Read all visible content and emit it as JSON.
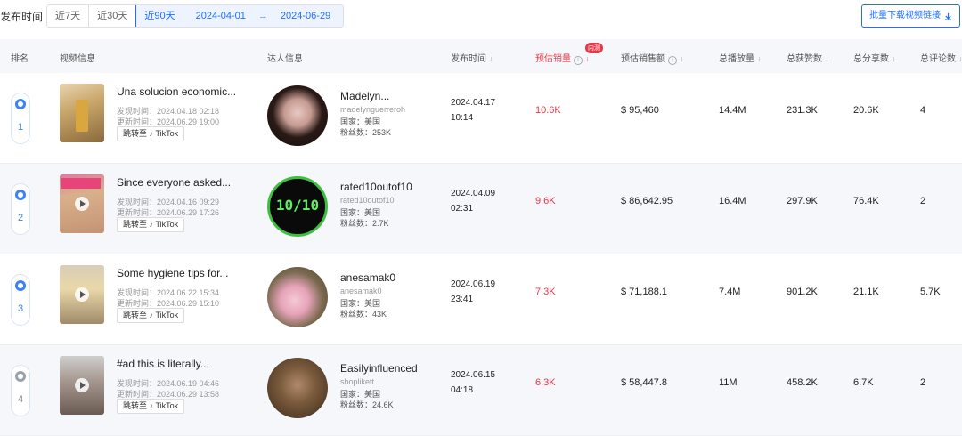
{
  "filter": {
    "label": "发布时间",
    "ranges": [
      "近7天",
      "近30天",
      "近90天"
    ],
    "date_start": "2024-04-01",
    "date_sep": "→",
    "date_end": "2024-06-29",
    "download_label": "批量下载视频链接"
  },
  "header": {
    "rank": "排名",
    "video": "视频信息",
    "creator": "达人信息",
    "publish": "发布时间",
    "sales": "预估销量",
    "revenue": "预估销售额",
    "plays": "总播放量",
    "likes": "总获赞数",
    "shares": "总分享数",
    "comments": "总评论数",
    "badge": "内测"
  },
  "labels": {
    "published_prefix": "发现时间：",
    "updated_prefix": "更新时间：",
    "country_prefix": "国家：",
    "fans_prefix": "粉丝数：",
    "tiktok_btn": "跳转至 ♪ TikTok"
  },
  "rows": [
    {
      "rank": "1",
      "title": "Una solucion economic...",
      "found": "发现时间：2024.04.18 02:18",
      "updated": "更新时间：2024.06.29 19:00",
      "creator_name": "Madelyn...",
      "creator_handle": "madelynguerreroh",
      "country": "国家：美国",
      "fans": "粉丝数：253K",
      "pub_date": "2024.04.17",
      "pub_time": "10:14",
      "sales": "10.6K",
      "revenue": "$ 95,460",
      "plays": "14.4M",
      "likes": "231.3K",
      "shares": "20.6K",
      "comments": "4"
    },
    {
      "rank": "2",
      "title": "Since everyone asked...",
      "found": "发现时间：2024.04.16 09:29",
      "updated": "更新时间：2024.06.29 17:26",
      "creator_name": "rated10outof10",
      "creator_handle": "rated10outof10",
      "country": "国家：美国",
      "fans": "粉丝数：2.7K",
      "pub_date": "2024.04.09",
      "pub_time": "02:31",
      "sales": "9.6K",
      "revenue": "$ 86,642.95",
      "plays": "16.4M",
      "likes": "297.9K",
      "shares": "76.4K",
      "comments": "2",
      "avatar_text": "10/10"
    },
    {
      "rank": "3",
      "title": "Some hygiene tips for...",
      "found": "发现时间：2024.06.22 15:34",
      "updated": "更新时间：2024.06.29 15:10",
      "creator_name": "anesamak0",
      "creator_handle": "anesamak0",
      "country": "国家：美国",
      "fans": "粉丝数：43K",
      "pub_date": "2024.06.19",
      "pub_time": "23:41",
      "sales": "7.3K",
      "revenue": "$ 71,188.1",
      "plays": "7.4M",
      "likes": "901.2K",
      "shares": "21.1K",
      "comments": "5.7K"
    },
    {
      "rank": "4",
      "title": "#ad this is literally...",
      "found": "发现时间：2024.06.19 04:46",
      "updated": "更新时间：2024.06.29 13:58",
      "creator_name": "Easilyinfluenced",
      "creator_handle": "shoplikett",
      "country": "国家：美国",
      "fans": "粉丝数：24.6K",
      "pub_date": "2024.06.15",
      "pub_time": "04:18",
      "sales": "6.3K",
      "revenue": "$ 58,447.8",
      "plays": "11M",
      "likes": "458.2K",
      "shares": "6.7K",
      "comments": "2"
    }
  ],
  "colors": {
    "accent": "#1e6fff",
    "sales_red": "#e5394b",
    "row_alt": "#f5f7fa"
  }
}
